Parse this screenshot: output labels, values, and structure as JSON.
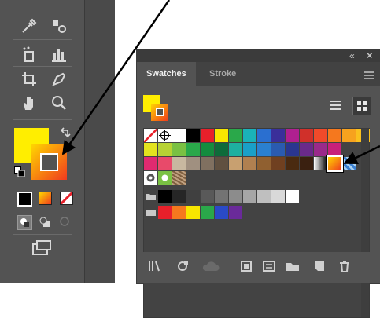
{
  "panel": {
    "tabs": [
      {
        "label": "Swatches"
      },
      {
        "label": "Stroke"
      }
    ],
    "collapse_glyph": "«",
    "close_glyph": "×"
  },
  "colors": {
    "fill": "#ffee00",
    "stroke_gradient_start": "#ffd600",
    "stroke_gradient_end": "#f03a1e",
    "arrow": "#000000",
    "toolbar_bg": "#535353",
    "panel_bg": "#535353"
  },
  "icons": [
    "eyedropper-icon",
    "blend-icon",
    "symbol-sprayer-icon",
    "column-graph-icon",
    "artboard-icon",
    "pen-icon",
    "hand-icon",
    "zoom-icon",
    "swap-icon",
    "default-colors-icon",
    "color-mode-icon",
    "gradient-mode-icon",
    "none-mode-icon",
    "draw-normal-icon",
    "draw-behind-icon",
    "draw-inside-icon",
    "screen-mode-icon",
    "list-view-icon",
    "grid-view-icon",
    "library-icon",
    "swatch-kind-icon",
    "cloud-icon",
    "swatch-options-icon",
    "new-group-icon",
    "new-swatch-icon",
    "delete-icon",
    "panel-menu-icon"
  ],
  "swatches": {
    "row1": [
      "none",
      "registration",
      "#ffffff",
      "#000000",
      "#e8202a",
      "#f7e600",
      "#2aa84a",
      "#1ab2b8",
      "#2a6fd0",
      "#3a2f9a",
      "#b02090",
      "#d0302a",
      "#f04a2a",
      "#f5781e",
      "#f7a21e",
      "#fac01e"
    ],
    "row2": [
      "#e3e31e",
      "#b7d234",
      "#7ac143",
      "#2aa84a",
      "#148c3e",
      "#0e6b3a",
      "#1eb0a0",
      "#1aa0c8",
      "#2a80d0",
      "#2a5bb0",
      "#2a3690",
      "#6a2a8a",
      "#9a2a8a",
      "#c8207a"
    ],
    "row3": [
      "#e02a70",
      "#e84a6a",
      "#c8b8a0",
      "#a09080",
      "#807060",
      "#605040",
      "#c8a070",
      "#b08050",
      "#906030",
      "#704020",
      "#4a2a10",
      "#3a2010",
      "gradient-bw",
      "gradient-selected",
      "pattern-blue"
    ],
    "row4": [
      "pattern-dots",
      "pattern-leaf",
      "pattern-texture"
    ],
    "row5": [
      "folder",
      "#000000",
      "#262626",
      "#404040",
      "#595959",
      "#737373",
      "#8c8c8c",
      "#a6a6a6",
      "#bfbfbf",
      "#d9d9d9",
      "#ffffff"
    ],
    "row6": [
      "folder",
      "#e8202a",
      "#f5781e",
      "#f7e600",
      "#2aa84a",
      "#2a4ac8",
      "#6a2a9a"
    ]
  }
}
